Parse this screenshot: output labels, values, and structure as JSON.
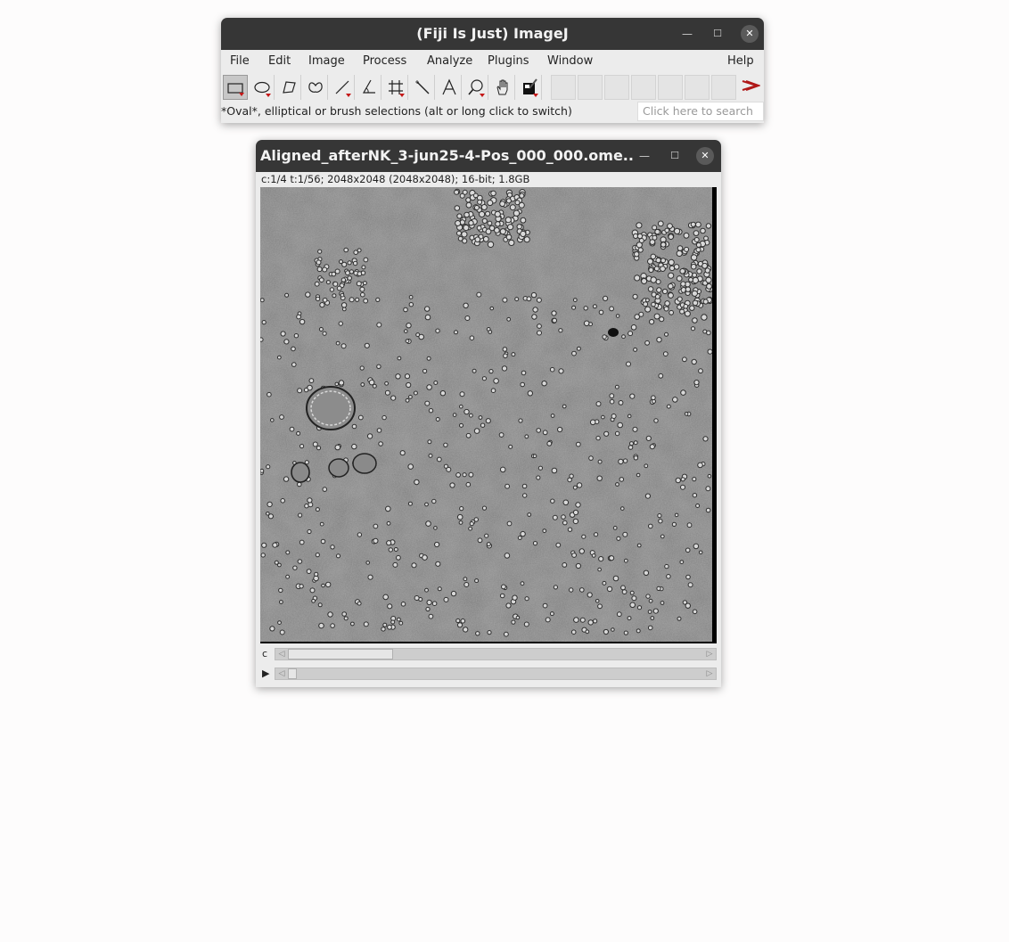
{
  "main_window": {
    "title": "(Fiji Is Just) ImageJ",
    "menu": [
      "File",
      "Edit",
      "Image",
      "Process",
      "Analyze",
      "Plugins",
      "Window",
      "Help"
    ],
    "status_text": "*Oval*, elliptical or brush selections (alt or long click to switch)",
    "search_placeholder": "Click here to search",
    "tools": [
      "rectangle-icon",
      "oval-icon",
      "polygon-icon",
      "freehand-icon",
      "line-icon",
      "angle-icon",
      "multipoint-icon",
      "wand-icon",
      "text-icon",
      "magnifier-icon",
      "hand-icon",
      "color-picker-icon"
    ],
    "selected_tool": "rectangle-icon"
  },
  "image_window": {
    "title": "Aligned_afterNK_3-jun25-4-Pos_000_000.ome...",
    "info": "c:1/4 t:1/56; 2048x2048   (2048x2048); 16-bit; 1.8GB",
    "channel_label": "c",
    "channel_position": 0.25,
    "frame_position": 0.0
  }
}
